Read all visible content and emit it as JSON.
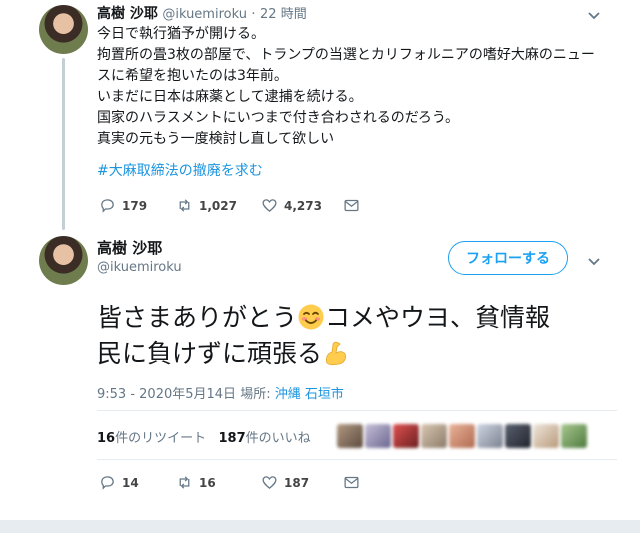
{
  "tweet1": {
    "name": "高樹 沙耶",
    "handle": "@ikuemiroku",
    "separator": "·",
    "time": "22 時間",
    "lines": [
      "今日で執行猶予が開ける。",
      "拘置所の畳3枚の部屋で、トランプの当選とカリフォルニアの嗜好大麻のニュー",
      "スに希望を抱いたのは3年前。",
      "いまだに日本は麻薬として逮捕を続ける。",
      "国家のハラスメントにいつまで付き合わされるのだろう。",
      "真実の元もう一度検討し直して欲しい"
    ],
    "hashtag": "#大麻取締法の撤廃を求む",
    "replies": "179",
    "retweets": "1,027",
    "likes": "4,273"
  },
  "tweet2": {
    "name": "高樹 沙耶",
    "handle": "@ikuemiroku",
    "follow_label": "フォローする",
    "line1_a": "皆さまありがとう",
    "line1_b": "コメやウヨ、貧情報",
    "line2": "民に負けずに頑張る",
    "time": "9:53 - 2020年5月14日",
    "location_label": "場所:",
    "location": "沖縄 石垣市",
    "retweet_count": "16",
    "retweet_label": "件のリツイート",
    "like_count": "187",
    "like_label": "件のいいね",
    "replies": "14",
    "retweets": "16",
    "likes": "187"
  },
  "icons": {
    "reply": "reply-icon",
    "retweet": "retweet-icon",
    "like": "heart-icon",
    "dm": "envelope-icon",
    "more": "chevron-down-icon",
    "emoji1": "smiling-face-emoji",
    "emoji2": "flexed-biceps-emoji"
  },
  "colors": {
    "link": "#1b95e0",
    "follow": "#1da1f2",
    "muted": "#657786",
    "thread": "#c4cfd6"
  }
}
